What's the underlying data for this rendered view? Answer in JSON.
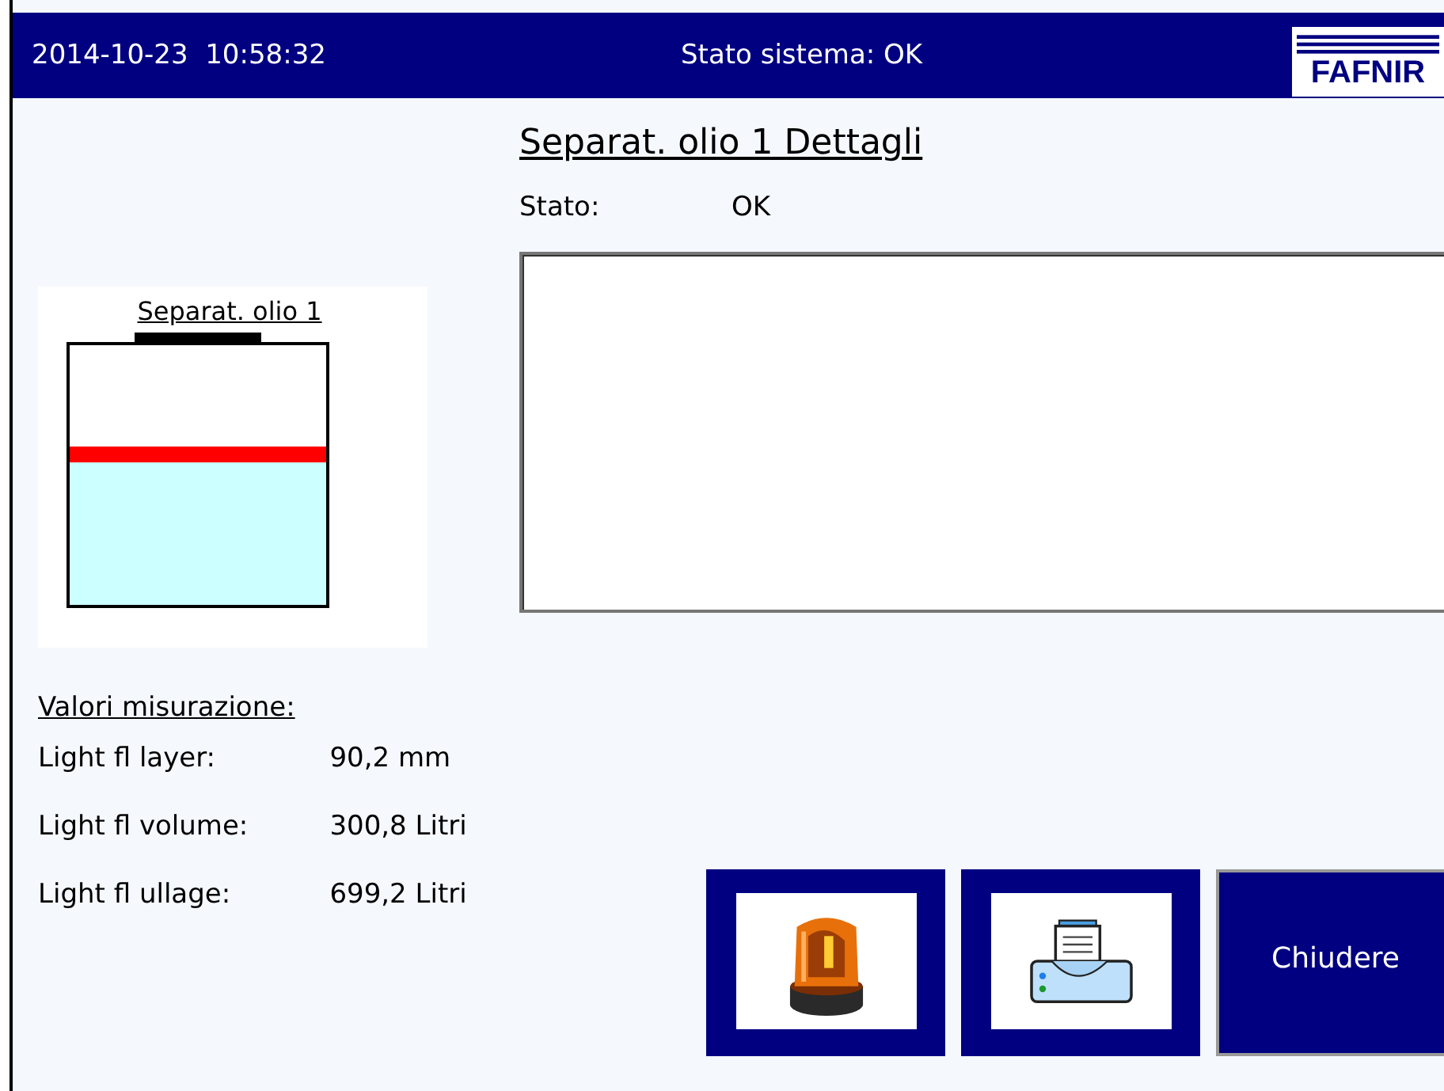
{
  "header": {
    "datetime": "2014-10-23  10:58:32",
    "system_status": "Stato sistema: OK",
    "logo": "FAFNIR"
  },
  "title": "Separat. olio 1 Dettagli",
  "status": {
    "label": "Stato:",
    "value": "OK"
  },
  "tank": {
    "name": "Separat. olio 1",
    "level": 0.55
  },
  "measurements": {
    "heading": "Valori misurazione:",
    "rows": [
      {
        "label": "Light fl layer:",
        "value": "90,2 mm"
      },
      {
        "label": "Light fl volume:",
        "value": "300,8 Litri"
      },
      {
        "label": "Light fl ullage:",
        "value": "699,2 Litri"
      }
    ]
  },
  "buttons": [
    {
      "kind": "alarm"
    },
    {
      "kind": "print"
    },
    {
      "kind": "text",
      "label": "Chiudere"
    }
  ]
}
